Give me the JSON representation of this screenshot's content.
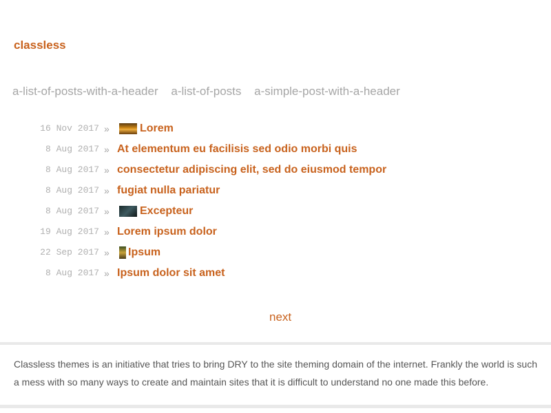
{
  "site": {
    "title": "classless"
  },
  "nav": {
    "items": [
      {
        "label": "a-list-of-posts-with-a-header"
      },
      {
        "label": "a-list-of-posts"
      },
      {
        "label": "a-simple-post-with-a-header"
      }
    ]
  },
  "posts": [
    {
      "date": "16 Nov 2017",
      "sep": "»",
      "title": "Lorem",
      "thumbnail": "sunset"
    },
    {
      "date": "8 Aug 2017",
      "sep": "»",
      "title": "At elementum eu facilisis sed odio morbi quis",
      "thumbnail": ""
    },
    {
      "date": "8 Aug 2017",
      "sep": "»",
      "title": "consectetur adipiscing elit, sed do eiusmod tempor",
      "thumbnail": ""
    },
    {
      "date": "8 Aug 2017",
      "sep": "»",
      "title": "fugiat nulla pariatur",
      "thumbnail": ""
    },
    {
      "date": "8 Aug 2017",
      "sep": "»",
      "title": "Excepteur",
      "thumbnail": "dark"
    },
    {
      "date": "19 Aug 2017",
      "sep": "»",
      "title": "Lorem ipsum dolor",
      "thumbnail": ""
    },
    {
      "date": "22 Sep 2017",
      "sep": "»",
      "title": "Ipsum",
      "thumbnail": "tall"
    },
    {
      "date": "8 Aug 2017",
      "sep": "»",
      "title": "Ipsum dolor sit amet",
      "thumbnail": ""
    }
  ],
  "pagination": {
    "next_label": "next"
  },
  "footer": {
    "text": "Classless themes is an initiative that tries to bring DRY to the site theming domain of the internet. Frankly the world is such a mess with so many ways to create and maintain sites that it is difficult to understand no one made this before."
  },
  "colors": {
    "accent": "#c8621d",
    "nav_text": "#a6a6a6",
    "date_text": "#b0b0b0",
    "footer_text": "#555555",
    "border": "#e9e9e9"
  }
}
